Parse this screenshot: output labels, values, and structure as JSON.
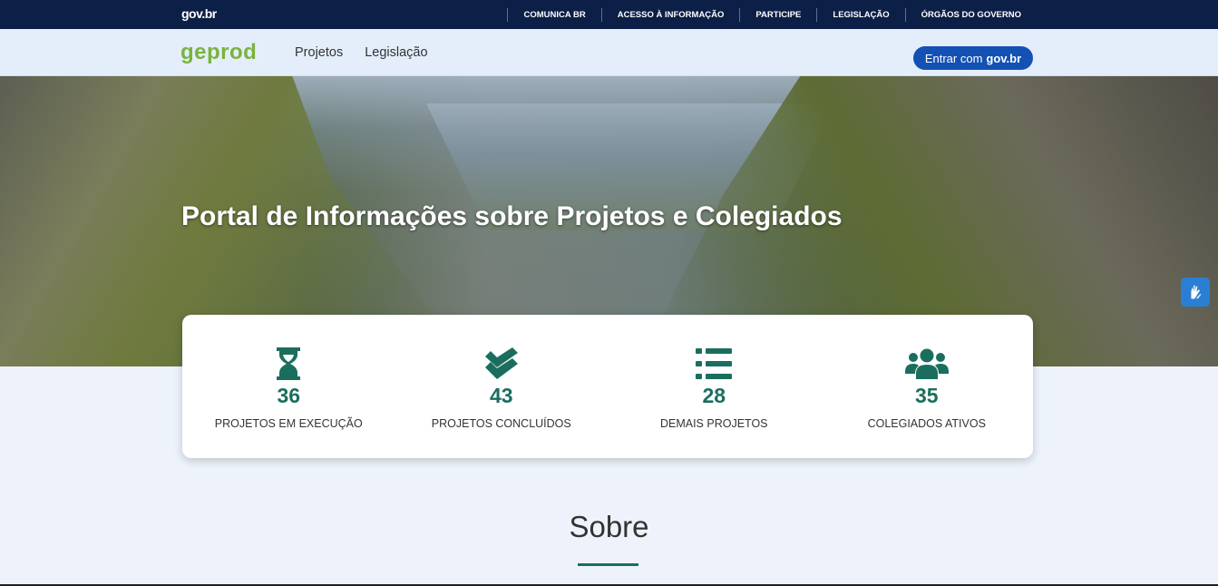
{
  "govbar": {
    "logo": "gov.br",
    "links": [
      "COMUNICA BR",
      "ACESSO À INFORMAÇÃO",
      "PARTICIPE",
      "LEGISLAÇÃO",
      "ÓRGÃOS DO GOVERNO"
    ]
  },
  "header": {
    "brand": "geprod",
    "nav": [
      "Projetos",
      "Legislação"
    ],
    "login_prefix": "Entrar com",
    "login_brand": "gov.br"
  },
  "hero": {
    "title": "Portal de Informações sobre Projetos e Colegiados"
  },
  "stats": [
    {
      "icon": "hourglass-icon",
      "value": "36",
      "label": "PROJETOS EM EXECUÇÃO"
    },
    {
      "icon": "double-check-icon",
      "value": "43",
      "label": "PROJETOS CONCLUÍDOS"
    },
    {
      "icon": "list-icon",
      "value": "28",
      "label": "DEMAIS PROJETOS"
    },
    {
      "icon": "users-icon",
      "value": "35",
      "label": "COLEGIADOS ATIVOS"
    }
  ],
  "about": {
    "title": "Sobre"
  },
  "colors": {
    "govbar": "#0c1f47",
    "brand_green": "#7ab33e",
    "accent_teal": "#1b6e5e",
    "login_blue": "#1351b4"
  }
}
